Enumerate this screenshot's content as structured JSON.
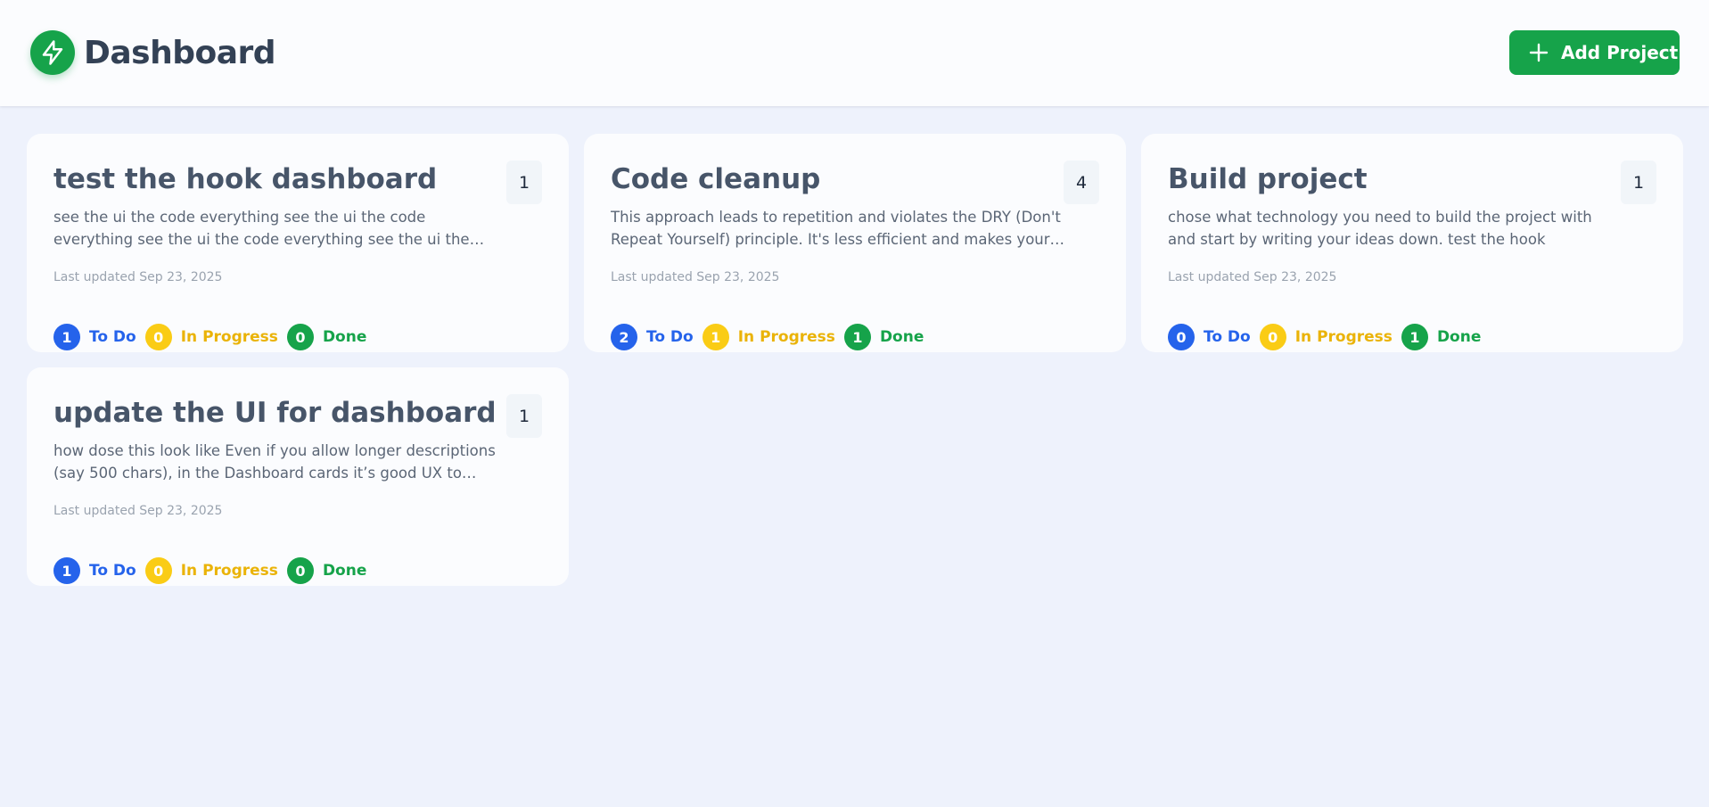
{
  "header": {
    "title": "Dashboard",
    "logo_icon": "lightning-bolt-icon",
    "add_button_label": "Add Project",
    "accent_color": "#16a34a"
  },
  "status_labels": {
    "todo": "To Do",
    "in_progress": "In Progress",
    "done": "Done"
  },
  "status_colors": {
    "todo": "#2563eb",
    "in_progress": "#facc15",
    "done": "#16a34a"
  },
  "projects": [
    {
      "title": "test the hook dashboard",
      "count": "1",
      "description": "see the ui the code everything see the ui the code everything see the ui the code everything see the ui the code everythings",
      "updated": "Last updated Sep 23, 2025",
      "todo": "1",
      "in_progress": "0",
      "done": "0"
    },
    {
      "title": "Code cleanup",
      "count": "4",
      "description": "This approach leads to repetition and violates the DRY (Don't Repeat Yourself) principle. It's less efficient and makes your cod...",
      "updated": "Last updated Sep 23, 2025",
      "todo": "2",
      "in_progress": "1",
      "done": "1"
    },
    {
      "title": "Build project",
      "count": "1",
      "description": "chose what technology you need to build the project with and start by writing your ideas down. test the hook",
      "updated": "Last updated Sep 23, 2025",
      "todo": "0",
      "in_progress": "0",
      "done": "1"
    },
    {
      "title": "update the UI for dashboard",
      "count": "1",
      "description": "how dose this look like Even if you allow longer descriptions (say 500 chars), in the Dashboard cards it’s good UX to truncate text...",
      "updated": "Last updated Sep 23, 2025",
      "todo": "1",
      "in_progress": "0",
      "done": "0"
    }
  ]
}
